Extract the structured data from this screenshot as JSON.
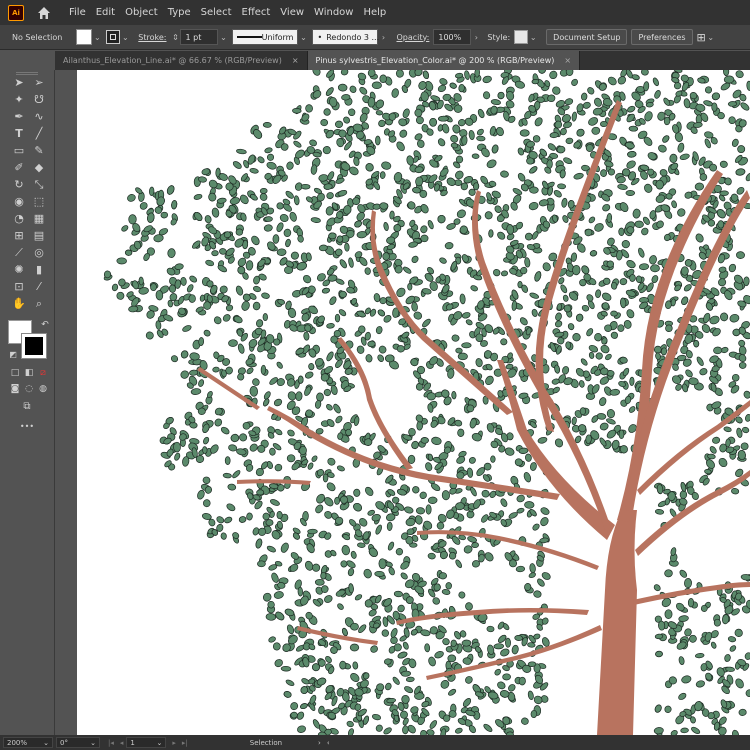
{
  "app": {
    "logo_text": "Ai"
  },
  "menu": [
    "File",
    "Edit",
    "Object",
    "Type",
    "Select",
    "Effect",
    "View",
    "Window",
    "Help"
  ],
  "control_bar": {
    "selection_label": "No Selection",
    "stroke_label": "Stroke:",
    "stroke_value": "1 pt",
    "profile_label": "Uniform",
    "brush_label": "Redondo 3 ...",
    "opacity_label": "Opacity:",
    "opacity_value": "100%",
    "style_label": "Style:",
    "document_setup": "Document Setup",
    "preferences": "Preferences"
  },
  "tabs": [
    {
      "label": "Ailanthus_Elevation_Line.ai* @ 66.67 % (RGB/Preview)",
      "active": false
    },
    {
      "label": "Pinus sylvestris_Elevation_Color.ai* @ 200 % (RGB/Preview)",
      "active": true
    }
  ],
  "status": {
    "zoom": "200%",
    "rotation": "0°",
    "artboard": "1",
    "mode": "Selection"
  },
  "colors": {
    "leaf_fill": "#5b8a6b",
    "leaf_stroke": "#1e2b24",
    "trunk": "#b8735f",
    "chrome_dark": "#323232",
    "chrome_mid": "#535353"
  },
  "icons": {
    "close_tab": "×",
    "home": "home-icon",
    "more_tools": "•••"
  }
}
